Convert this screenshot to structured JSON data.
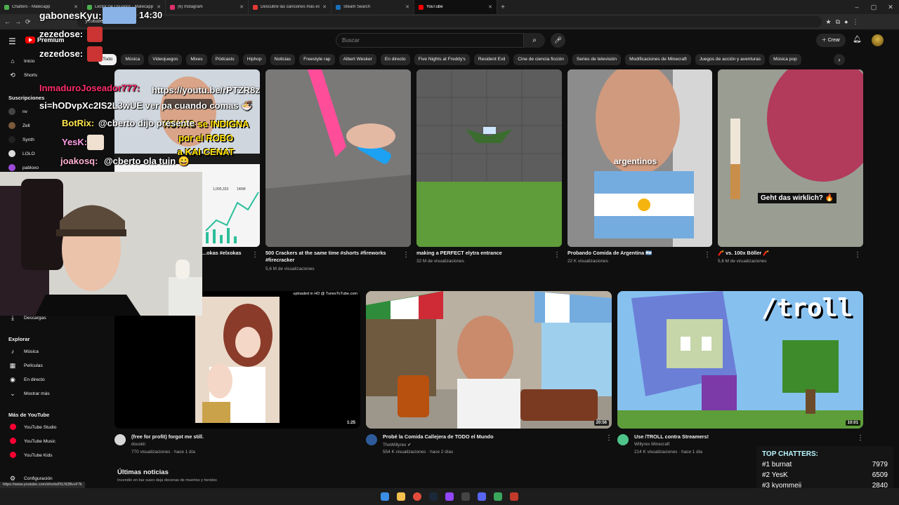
{
  "browser": {
    "tabs": [
      {
        "label": "Chatters - Matecapp",
        "color": "#4caf50"
      },
      {
        "label": "Lector De Usuarios - Matecapp",
        "color": "#4caf50"
      },
      {
        "label": "(6) Instagram",
        "color": "#e1306c"
      },
      {
        "label": "Descubre las canciones más escuchadas",
        "color": "#e53935"
      },
      {
        "label": "Steam Search",
        "color": "#1b6fb8"
      },
      {
        "label": "YouTube",
        "color": "#ff0000"
      }
    ],
    "url": "youtube.com",
    "time": "14:30"
  },
  "header": {
    "logo_text": "Premium",
    "search_placeholder": "Buscar",
    "create_label": "Crear"
  },
  "chips": [
    "Todo",
    "Música",
    "Videojuegos",
    "Mixes",
    "Pódcasts",
    "Hiphop",
    "Noticias",
    "Freestyle rap",
    "Albert Wesker",
    "En directo",
    "Five Nights at Freddy's",
    "Resident Evil",
    "Cine de ciencia ficción",
    "Series de televisión",
    "Modificaciones de Minecraft",
    "Juegos de acción y aventuras",
    "Música pop"
  ],
  "sidebar": {
    "home": "Inicio",
    "shorts": "Shorts",
    "subs_title": "Suscripciones",
    "subs": [
      {
        "name": "nv",
        "color": "#444"
      },
      {
        "name": "Zell",
        "color": "#7a5a3a"
      },
      {
        "name": "Synth",
        "color": "#222"
      },
      {
        "name": "LOLO",
        "color": "#ddd"
      },
      {
        "name": "pabloxo",
        "color": "#9c4ad8"
      }
    ],
    "downloads": "Descargas",
    "explore_title": "Explorar",
    "explore": [
      "Música",
      "Películas",
      "En directo",
      "Mostrar más"
    ],
    "more_title": "Más de YouTube",
    "more": [
      "YouTube Studio",
      "YouTube Music",
      "YouTube Kids"
    ],
    "settings": "Configuración"
  },
  "shorts": [
    {
      "title": "...okas #elxokas",
      "views": ""
    },
    {
      "title": "500 Crackers at the same time #shorts #fireworks #firecracker",
      "views": "5,6 M de visualizaciones"
    },
    {
      "title": "making a PERFECT elytra entrance",
      "views": "32 M de visualizaciones"
    },
    {
      "title": "Probando Comida de Argentina 🇦🇷",
      "views": "22 K visualizaciones",
      "overlay": "argentinos"
    },
    {
      "title": "🧨 vs. 100x Böller 🧨",
      "views": "5,6 M de visualizaciones",
      "overlay": "Geht das wirklich? 🔥"
    }
  ],
  "short_overlay_text": [
    "XOKAS se INDIGNA",
    "por el ROBO",
    "a KAI CENAT"
  ],
  "short_stats": [
    "1,005,333",
    "140M"
  ],
  "videos": [
    {
      "title": "(free for profit) forgot me still.",
      "channel": "douskii",
      "meta": "770 visualizaciones · hace 1 día",
      "duration": "1:25",
      "banner": "uploaded in HD @ TunesToTube.com"
    },
    {
      "title": "Probé la Comida Callejera de TODO el Mundo",
      "channel": "TheWillyrex ✔",
      "meta": "554 K visualizaciones · hace 2 días",
      "duration": "20:56"
    },
    {
      "title": "Use /TROLL contra Streamers!",
      "channel": "Willyrex Minecraft",
      "meta": "214 K visualizaciones · hace 1 día",
      "duration": "10:01",
      "overlay": "/troll"
    }
  ],
  "section": {
    "title": "Últimas noticias",
    "subtitle": "Incendio en bar suizo deja decenas de muertos y heridos"
  },
  "status_url": "https://www.youtube.com/shorts/fXLN3BvvF7k",
  "stream_chat": [
    {
      "user": "gabonesKyu:",
      "msg": "",
      "color": "#ffffff"
    },
    {
      "user": "zezedose:",
      "msg": "",
      "color": "#ffffff"
    },
    {
      "user": "zezedose:",
      "msg": "",
      "color": "#ffffff"
    },
    {
      "user": "InmaduroJoseador777:",
      "msg": "https://youtu.be/rPTZR8z si=hODvpXc2IS2L3wUE ver pa cuando comas 🍜",
      "color": "#ff2d6e"
    },
    {
      "user": "BotRix:",
      "msg": "@cberto dijo presente",
      "color": "#ffe64d"
    },
    {
      "user": "YesK:",
      "msg": "",
      "color": "#ff9de6"
    },
    {
      "user": "joakosq:",
      "msg": "@cberto ola tuin 😀",
      "color": "#ffb0d0"
    }
  ],
  "top_chatters": {
    "title": "TOP CHATTERS:",
    "rows": [
      {
        "rank": "#1",
        "name": "burnat",
        "count": "7979"
      },
      {
        "rank": "#2",
        "name": "YesK",
        "count": "6509"
      },
      {
        "rank": "#3",
        "name": "kyommeii",
        "count": "2840"
      }
    ]
  }
}
